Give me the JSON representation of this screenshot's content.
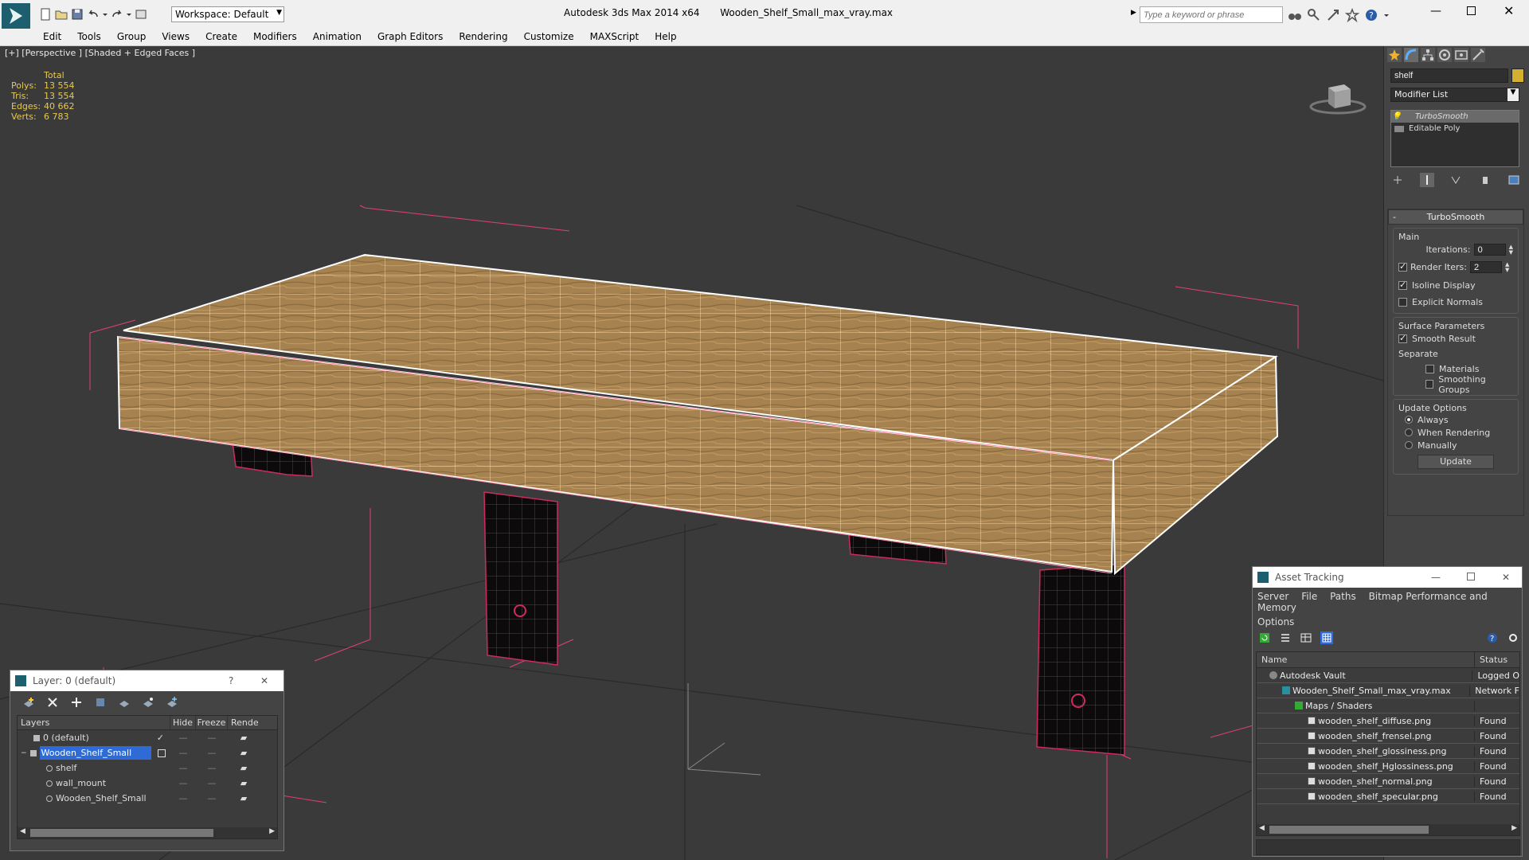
{
  "titlebar": {
    "app_title": "Autodesk 3ds Max  2014 x64",
    "file_title": "Wooden_Shelf_Small_max_vray.max",
    "workspace": "Workspace: Default",
    "search_placeholder": "Type a keyword or phrase"
  },
  "menu": [
    "Edit",
    "Tools",
    "Group",
    "Views",
    "Create",
    "Modifiers",
    "Animation",
    "Graph Editors",
    "Rendering",
    "Customize",
    "MAXScript",
    "Help"
  ],
  "viewport": {
    "label": "[+] [Perspective ] [Shaded + Edged Faces ]",
    "stats": {
      "header": "Total",
      "rows": [
        {
          "label": "Polys:",
          "value": "13 554"
        },
        {
          "label": "Tris:",
          "value": "13 554"
        },
        {
          "label": "Edges:",
          "value": "40 662"
        },
        {
          "label": "Verts:",
          "value": "6 783"
        }
      ]
    },
    "colors": {
      "background": "#3a3a3a",
      "wood": "#a5824f",
      "wire_selected": "#ffffff",
      "wire_dark": "#c0205a",
      "bbox": "#e0407a"
    }
  },
  "cmdpanel": {
    "object_name": "shelf",
    "object_color": "#d4b030",
    "modifier_list": "Modifier List",
    "stack": [
      "TurboSmooth",
      "Editable Poly"
    ],
    "turbosmooth": {
      "title": "TurboSmooth",
      "main_title": "Main",
      "iterations_label": "Iterations:",
      "iterations": "0",
      "render_iters_label": "Render Iters:",
      "render_iters": "2",
      "isoline": "Isoline Display",
      "explicit": "Explicit Normals",
      "surface_title": "Surface Parameters",
      "smooth_result": "Smooth Result",
      "separate": "Separate",
      "materials": "Materials",
      "smoothing_groups": "Smoothing Groups",
      "update_title": "Update Options",
      "always": "Always",
      "when_rendering": "When Rendering",
      "manually": "Manually",
      "update_btn": "Update"
    }
  },
  "layer_dialog": {
    "title": "Layer: 0 (default)",
    "help": "?",
    "close": "✕",
    "columns": [
      "Layers",
      "Hide",
      "Freeze",
      "Rende"
    ],
    "rows": [
      {
        "name": "0 (default)",
        "indent": 0,
        "selected": false
      },
      {
        "name": "Wooden_Shelf_Small",
        "indent": 0,
        "selected": true
      },
      {
        "name": "shelf",
        "indent": 1,
        "selected": false
      },
      {
        "name": "wall_mount",
        "indent": 1,
        "selected": false
      },
      {
        "name": "Wooden_Shelf_Small",
        "indent": 1,
        "selected": false
      }
    ]
  },
  "asset_tracking": {
    "title": "Asset Tracking",
    "menu": [
      "Server",
      "File",
      "Paths",
      "Bitmap Performance and Memory"
    ],
    "menu2": "Options",
    "columns": [
      "Name",
      "Status"
    ],
    "rows": [
      {
        "name": "Autodesk Vault",
        "status": "Logged O",
        "indent": 1
      },
      {
        "name": "Wooden_Shelf_Small_max_vray.max",
        "status": "Network F",
        "indent": 2
      },
      {
        "name": "Maps / Shaders",
        "status": "",
        "indent": 3
      },
      {
        "name": "wooden_shelf_diffuse.png",
        "status": "Found",
        "indent": 4
      },
      {
        "name": "wooden_shelf_frensel.png",
        "status": "Found",
        "indent": 4
      },
      {
        "name": "wooden_shelf_glossiness.png",
        "status": "Found",
        "indent": 4
      },
      {
        "name": "wooden_shelf_Hglossiness.png",
        "status": "Found",
        "indent": 4
      },
      {
        "name": "wooden_shelf_normal.png",
        "status": "Found",
        "indent": 4
      },
      {
        "name": "wooden_shelf_specular.png",
        "status": "Found",
        "indent": 4
      }
    ]
  }
}
